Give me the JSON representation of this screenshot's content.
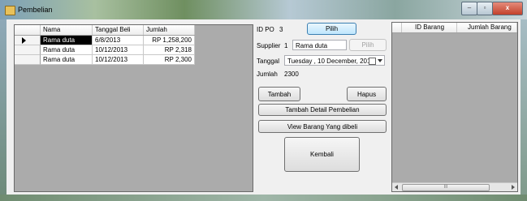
{
  "window": {
    "title": "Pembelian",
    "min_symbol": "–",
    "max_symbol": "▫",
    "close_symbol": "x"
  },
  "pembelian_grid": {
    "columns": [
      "Nama",
      "Tanggal Beli",
      "Jumlah"
    ],
    "rows": [
      {
        "nama": "Rama duta",
        "tanggal": "6/8/2013",
        "jumlah": "RP 1,258,200"
      },
      {
        "nama": "Rama duta",
        "tanggal": "10/12/2013",
        "jumlah": "RP 2,318"
      },
      {
        "nama": "Rama duta",
        "tanggal": "10/12/2013",
        "jumlah": "RP 2,300"
      }
    ]
  },
  "form": {
    "id_po_label": "ID PO",
    "id_po_value": "3",
    "pilih_po_label": "Pilih",
    "supplier_label": "Supplier",
    "supplier_id": "1",
    "supplier_name": "Rama duta",
    "pilih_supplier_label": "Pilih",
    "tanggal_label": "Tanggal",
    "tanggal_value": "Tuesday  , 10 December, 2013",
    "jumlah_label": "Jumlah",
    "jumlah_value": "2300",
    "tambah_label": "Tambah",
    "hapus_label": "Hapus",
    "tambah_detail_label": "Tambah Detail Pembelian",
    "view_barang_label": "View Barang Yang dibeli",
    "kembali_label": "Kembali"
  },
  "barang_grid": {
    "columns": [
      "ID Barang",
      "Jumlah Barang"
    ],
    "scroll_thumb": "III"
  },
  "colors": {
    "grid_background": "#ababab",
    "selected_cell": "#000000"
  }
}
